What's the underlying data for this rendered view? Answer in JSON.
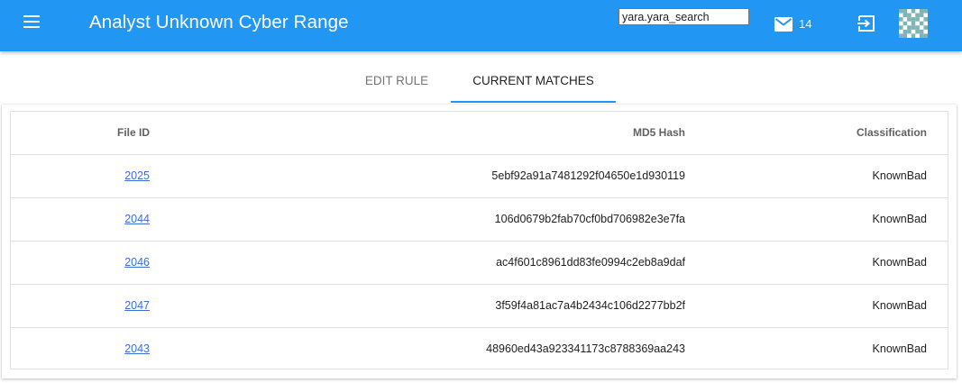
{
  "appbar": {
    "title": "Analyst Unknown Cyber Range",
    "search_value": "yara.yara_search",
    "mail_count": "14",
    "color": "#2196f3"
  },
  "tabs": [
    {
      "label": "EDIT RULE",
      "active": false
    },
    {
      "label": "CURRENT MATCHES",
      "active": true
    }
  ],
  "table": {
    "headers": {
      "file_id": "File ID",
      "md5": "MD5 Hash",
      "classification": "Classification"
    },
    "rows": [
      {
        "file_id": "2025",
        "md5": "5ebf92a91a7481292f04650e1d930119",
        "classification": "KnownBad"
      },
      {
        "file_id": "2044",
        "md5": "106d0679b2fab70cf0bd706982e3e7fa",
        "classification": "KnownBad"
      },
      {
        "file_id": "2046",
        "md5": "ac4f601c8961dd83fe0994c2eb8a9daf",
        "classification": "KnownBad"
      },
      {
        "file_id": "2047",
        "md5": "3f59f4a81ac7a4b2434c106d2277bb2f",
        "classification": "KnownBad"
      },
      {
        "file_id": "2043",
        "md5": "48960ed43a923341173c8788369aa243",
        "classification": "KnownBad"
      }
    ]
  },
  "icons": {
    "menu": "menu-icon",
    "mail": "mail-icon",
    "logout": "logout-icon",
    "avatar": "identicon-avatar"
  }
}
